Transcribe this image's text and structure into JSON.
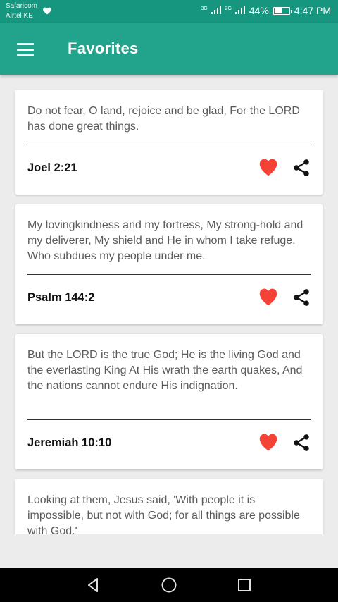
{
  "status_bar": {
    "carrier_1": "Safaricom",
    "carrier_2": "Airtel KE",
    "network_1": "3G",
    "network_2": "2G",
    "battery": "44%",
    "time": "4:47 PM"
  },
  "app_bar": {
    "title": "Favorites",
    "menu_icon": "hamburger-menu-icon"
  },
  "favorites": [
    {
      "text": "Do not fear, O land, rejoice and be glad, For the LORD has done great things.",
      "reference": "Joel 2:21"
    },
    {
      "text": "My lovingkindness and my fortress, My strong-hold and my deliverer, My shield and He in whom I take refuge, Who subdues my people under me.",
      "reference": "Psalm 144:2"
    },
    {
      "text": "But the LORD is the true God; He is the living God and the everlasting King At His wrath the earth quakes, And the nations cannot endure His indignation.",
      "reference": "Jeremiah 10:10"
    },
    {
      "text": "Looking at them, Jesus said, 'With people it is impossible, but not with God; for all things are possible with God.'",
      "reference": ""
    }
  ],
  "icons": {
    "favorite": "heart-icon",
    "share": "share-icon",
    "back": "back-triangle-icon",
    "home": "home-circle-icon",
    "recent": "recent-apps-square-icon"
  },
  "colors": {
    "status_bar": "#17967f",
    "app_bar": "#22a38b",
    "heart": "#f44336",
    "background": "#ececec"
  }
}
